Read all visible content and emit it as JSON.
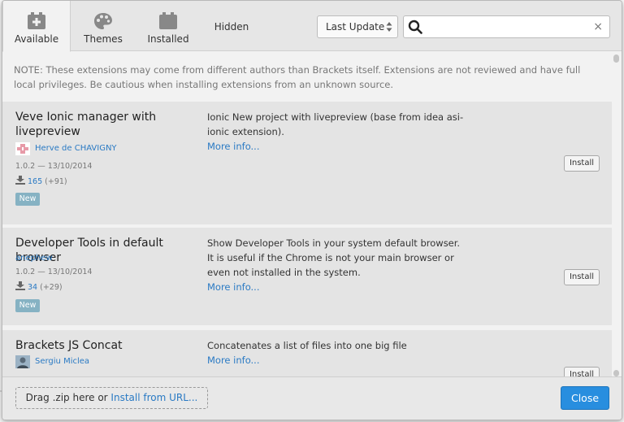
{
  "tabs": [
    {
      "label": "Available",
      "icon": "plus-box-icon"
    },
    {
      "label": "Themes",
      "icon": "palette-icon"
    },
    {
      "label": "Installed",
      "icon": "stack-icon"
    },
    {
      "label": "Hidden"
    }
  ],
  "sort": {
    "selected": "Last Update"
  },
  "search": {
    "value": "",
    "placeholder": "",
    "clear": "×"
  },
  "notice": "NOTE: These extensions may come from different authors than Brackets itself. Extensions are not reviewed and have full local privileges. Be cautious when installing extensions from an unknown source.",
  "extensions": [
    {
      "name": "Veve Ionic manager with livepreview",
      "author": "Herve de CHAVIGNY",
      "version_date": "1.0.2 — 13/10/2014",
      "downloads": "165",
      "downloads_delta": "(+91)",
      "badge": "New",
      "description": "Ionic New project with livepreview (base from idea asi-ionic extension).",
      "more": "More info...",
      "install": "Install"
    },
    {
      "name": "Developer Tools in default browser",
      "author": "anephew",
      "version_date": "1.0.2 — 13/10/2014",
      "downloads": "34",
      "downloads_delta": "(+29)",
      "badge": "New",
      "description": "Show Developer Tools in your system default browser. It is useful if the Chrome is not your main browser or even not installed in the system.",
      "more": "More info...",
      "install": "Install"
    },
    {
      "name": "Brackets JS Concat",
      "author": "Sergiu Miclea",
      "description": "Concatenates a list of files into one big file",
      "more": "More info...",
      "install": "Install"
    }
  ],
  "footer": {
    "drag_text": "Drag .zip here or",
    "install_url": "Install from URL...",
    "close": "Close"
  },
  "colors": {
    "accent": "#288edf",
    "link": "#2a7ac4",
    "badge": "#86b2c3"
  }
}
